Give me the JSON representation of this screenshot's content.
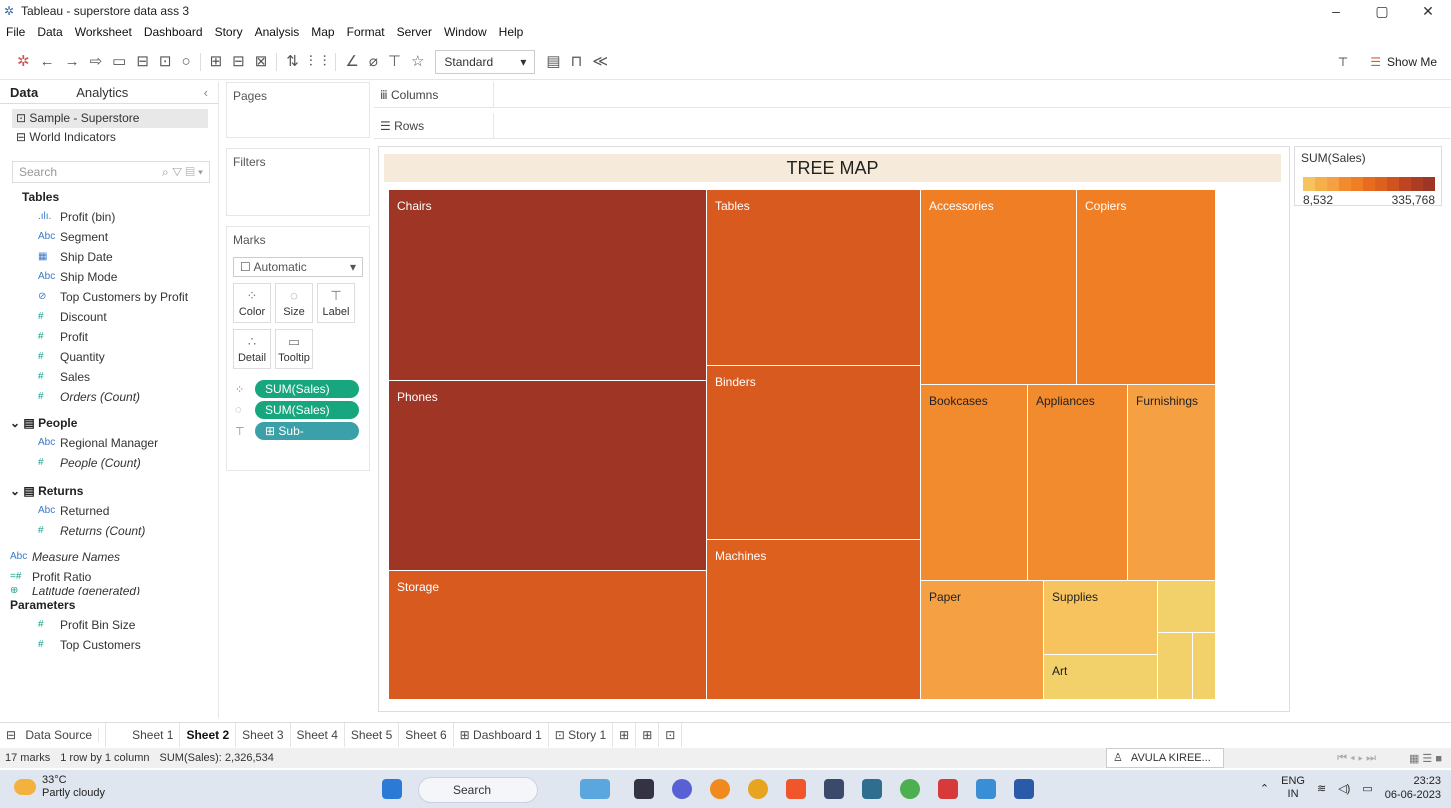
{
  "window": {
    "title": "Tableau - superstore data ass 3",
    "controls": [
      "–",
      "▢",
      "✕"
    ]
  },
  "menu": [
    "File",
    "Data",
    "Worksheet",
    "Dashboard",
    "Story",
    "Analysis",
    "Map",
    "Format",
    "Server",
    "Window",
    "Help"
  ],
  "toolbar": {
    "fit": "Standard",
    "show_me": "Show Me"
  },
  "data_pane": {
    "tabs": [
      "Data",
      "Analytics"
    ],
    "sources": [
      "Sample - Superstore",
      "World Indicators"
    ],
    "search_placeholder": "Search",
    "tables_heading": "Tables",
    "fields": [
      {
        "icon": ".ılı.",
        "label": "Profit (bin)",
        "italic": false
      },
      {
        "icon": "Abc",
        "label": "Segment",
        "italic": false
      },
      {
        "icon": "▦",
        "label": "Ship Date",
        "italic": false
      },
      {
        "icon": "Abc",
        "label": "Ship Mode",
        "italic": false
      },
      {
        "icon": "⊘",
        "label": "Top Customers by Profit",
        "italic": false
      },
      {
        "icon": "#",
        "label": "Discount",
        "italic": false
      },
      {
        "icon": "#",
        "label": "Profit",
        "italic": false
      },
      {
        "icon": "#",
        "label": "Quantity",
        "italic": false
      },
      {
        "icon": "#",
        "label": "Sales",
        "italic": false
      },
      {
        "icon": "#",
        "label": "Orders (Count)",
        "italic": true
      }
    ],
    "people": {
      "heading": "People",
      "fields": [
        {
          "icon": "Abc",
          "label": "Regional Manager"
        },
        {
          "icon": "#",
          "label": "People (Count)"
        }
      ]
    },
    "returns": {
      "heading": "Returns",
      "fields": [
        {
          "icon": "Abc",
          "label": "Returned"
        },
        {
          "icon": "#",
          "label": "Returns (Count)"
        }
      ]
    },
    "extra": [
      {
        "icon": "Abc",
        "label": "Measure Names"
      },
      {
        "icon": "=#",
        "label": "Profit Ratio"
      },
      {
        "icon": "⊕",
        "label": "Latitude (generated)"
      }
    ],
    "parameters_heading": "Parameters",
    "parameters": [
      "Profit Bin Size",
      "Top Customers"
    ]
  },
  "shelves": {
    "pages": "Pages",
    "filters": "Filters",
    "marks": "Marks",
    "columns": "Columns",
    "rows": "Rows"
  },
  "marks": {
    "type": "Automatic",
    "buttons": [
      "Color",
      "Size",
      "Label",
      "Detail",
      "Tooltip"
    ],
    "pills": [
      "SUM(Sales)",
      "SUM(Sales)",
      "⊞ Sub-Catego.."
    ]
  },
  "viz": {
    "title": "TREE MAP",
    "cells": [
      {
        "label": "Chairs",
        "color": "#9e3525"
      },
      {
        "label": "Phones",
        "color": "#9e3525"
      },
      {
        "label": "Storage",
        "color": "#d95a1f"
      },
      {
        "label": "Tables",
        "color": "#d95a1f"
      },
      {
        "label": "Binders",
        "color": "#d95a1f"
      },
      {
        "label": "Machines",
        "color": "#dd601f"
      },
      {
        "label": "Accessories",
        "color": "#f07e24"
      },
      {
        "label": "Copiers",
        "color": "#f07e24"
      },
      {
        "label": "Bookcases",
        "color": "#f28a2e"
      },
      {
        "label": "Appliances",
        "color": "#f28a2e"
      },
      {
        "label": "Furnishings",
        "color": "#f5a143"
      },
      {
        "label": "Paper",
        "color": "#f5a143"
      },
      {
        "label": "Supplies",
        "color": "#f6c35e"
      },
      {
        "label": "Art",
        "color": "#f2d06a"
      },
      {
        "label": "",
        "color": "#f2d06a"
      },
      {
        "label": "",
        "color": "#f2d06a"
      },
      {
        "label": "",
        "color": "#f2d06a"
      }
    ]
  },
  "legend": {
    "title": "SUM(Sales)",
    "min": "8,532",
    "max": "335,768",
    "colors": [
      "#f6c35e",
      "#f5b04a",
      "#f5a143",
      "#f28a2e",
      "#f07e24",
      "#e86c20",
      "#dd601f",
      "#d0521f",
      "#bf4522",
      "#ad3c24",
      "#9e3525"
    ]
  },
  "sheet_tabs": [
    "Data Source",
    "Sheet 1",
    "Sheet 2",
    "Sheet 3",
    "Sheet 4",
    "Sheet 5",
    "Sheet 6",
    "⊞ Dashboard 1",
    "⊡ Story 1"
  ],
  "active_tab": "Sheet 2",
  "status": {
    "marks": "17 marks",
    "layout": "1 row by 1 column",
    "sum": "SUM(Sales): 2,326,534",
    "user": "AVULA KIREE..."
  },
  "taskbar": {
    "temp": "33°C",
    "weather": "Partly cloudy",
    "search": "Search",
    "lang1": "ENG",
    "lang2": "IN",
    "time": "23:23",
    "date": "06-06-2023"
  }
}
